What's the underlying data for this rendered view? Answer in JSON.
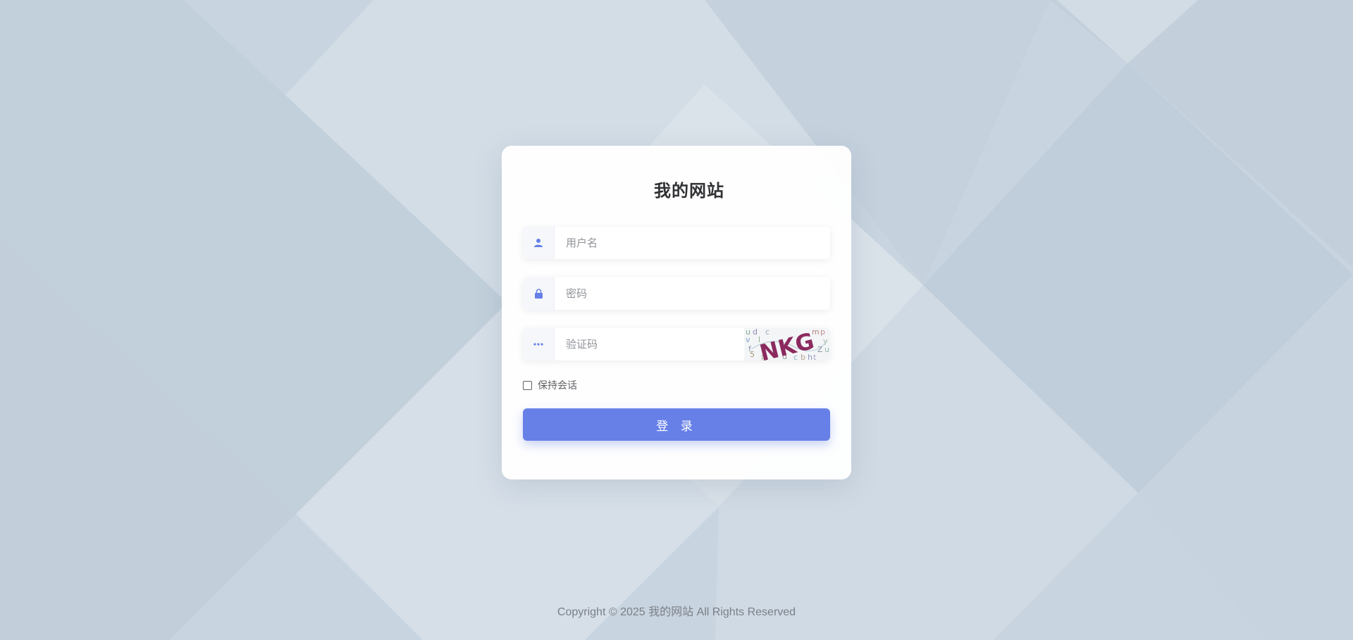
{
  "site": {
    "title": "我的网站"
  },
  "form": {
    "username": {
      "placeholder": "用户名",
      "value": "",
      "icon": "user-icon"
    },
    "password": {
      "placeholder": "密码",
      "value": "",
      "icon": "lock-icon"
    },
    "captcha": {
      "placeholder": "验证码",
      "value": "",
      "icon": "dots-icon",
      "image_text": "NKG"
    },
    "remember_label": "保持会话",
    "remember_checked": false,
    "submit_label": "登 录"
  },
  "footer": {
    "copyright": "Copyright © 2025 我的网站 All Rights Reserved"
  },
  "colors": {
    "accent": "#6780e8",
    "background": "#c9d5e0",
    "captcha_text": "#8b2a5f"
  }
}
